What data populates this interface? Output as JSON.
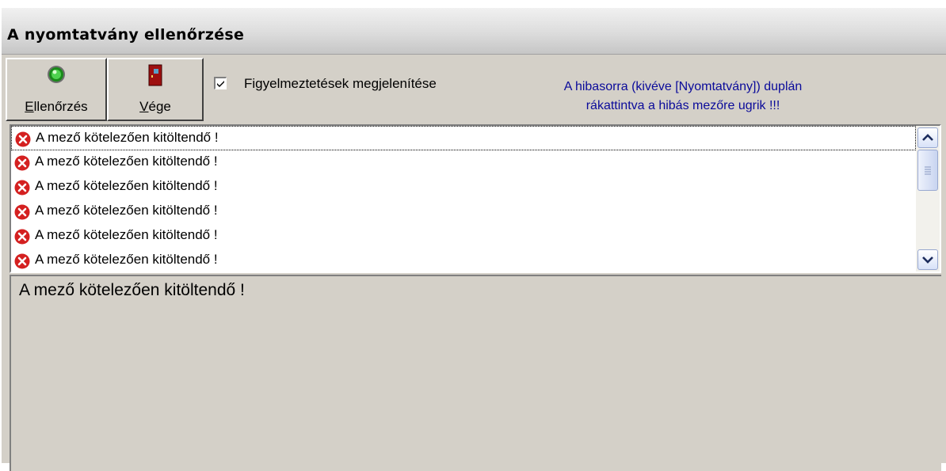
{
  "window": {
    "title": "A nyomtatvány ellenőrzése"
  },
  "toolbar": {
    "check_button": {
      "mnemonic": "E",
      "label_rest": "llenőrzés",
      "icon": "green-bulb-icon"
    },
    "exit_button": {
      "mnemonic": "V",
      "label_rest": "ége",
      "icon": "door-icon"
    },
    "show_warnings": {
      "label": "Figyelmeztetések megjelenítése",
      "checked": true
    },
    "hint_line1": "A hibasorra (kivéve [Nyomtatvány]) duplán",
    "hint_line2": "rákattintva a hibás  mezőre ugrik !!!"
  },
  "errors": {
    "items": [
      {
        "text": "A mező kötelezően kitöltendő !",
        "icon": "error-icon",
        "selected": true
      },
      {
        "text": "A mező kötelezően kitöltendő !",
        "icon": "error-icon",
        "selected": false
      },
      {
        "text": "A mező kötelezően kitöltendő !",
        "icon": "error-icon",
        "selected": false
      },
      {
        "text": "A mező kötelezően kitöltendő !",
        "icon": "error-icon",
        "selected": false
      },
      {
        "text": "A mező kötelezően kitöltendő !",
        "icon": "error-icon",
        "selected": false
      },
      {
        "text": "A mező kötelezően kitöltendő !",
        "icon": "error-icon",
        "selected": false
      }
    ]
  },
  "detail": {
    "text": "A mező kötelezően kitöltendő !"
  },
  "colors": {
    "hint_text": "#0a0a9a",
    "error_icon": "#d42020",
    "window_bg": "#d4d0c8"
  }
}
